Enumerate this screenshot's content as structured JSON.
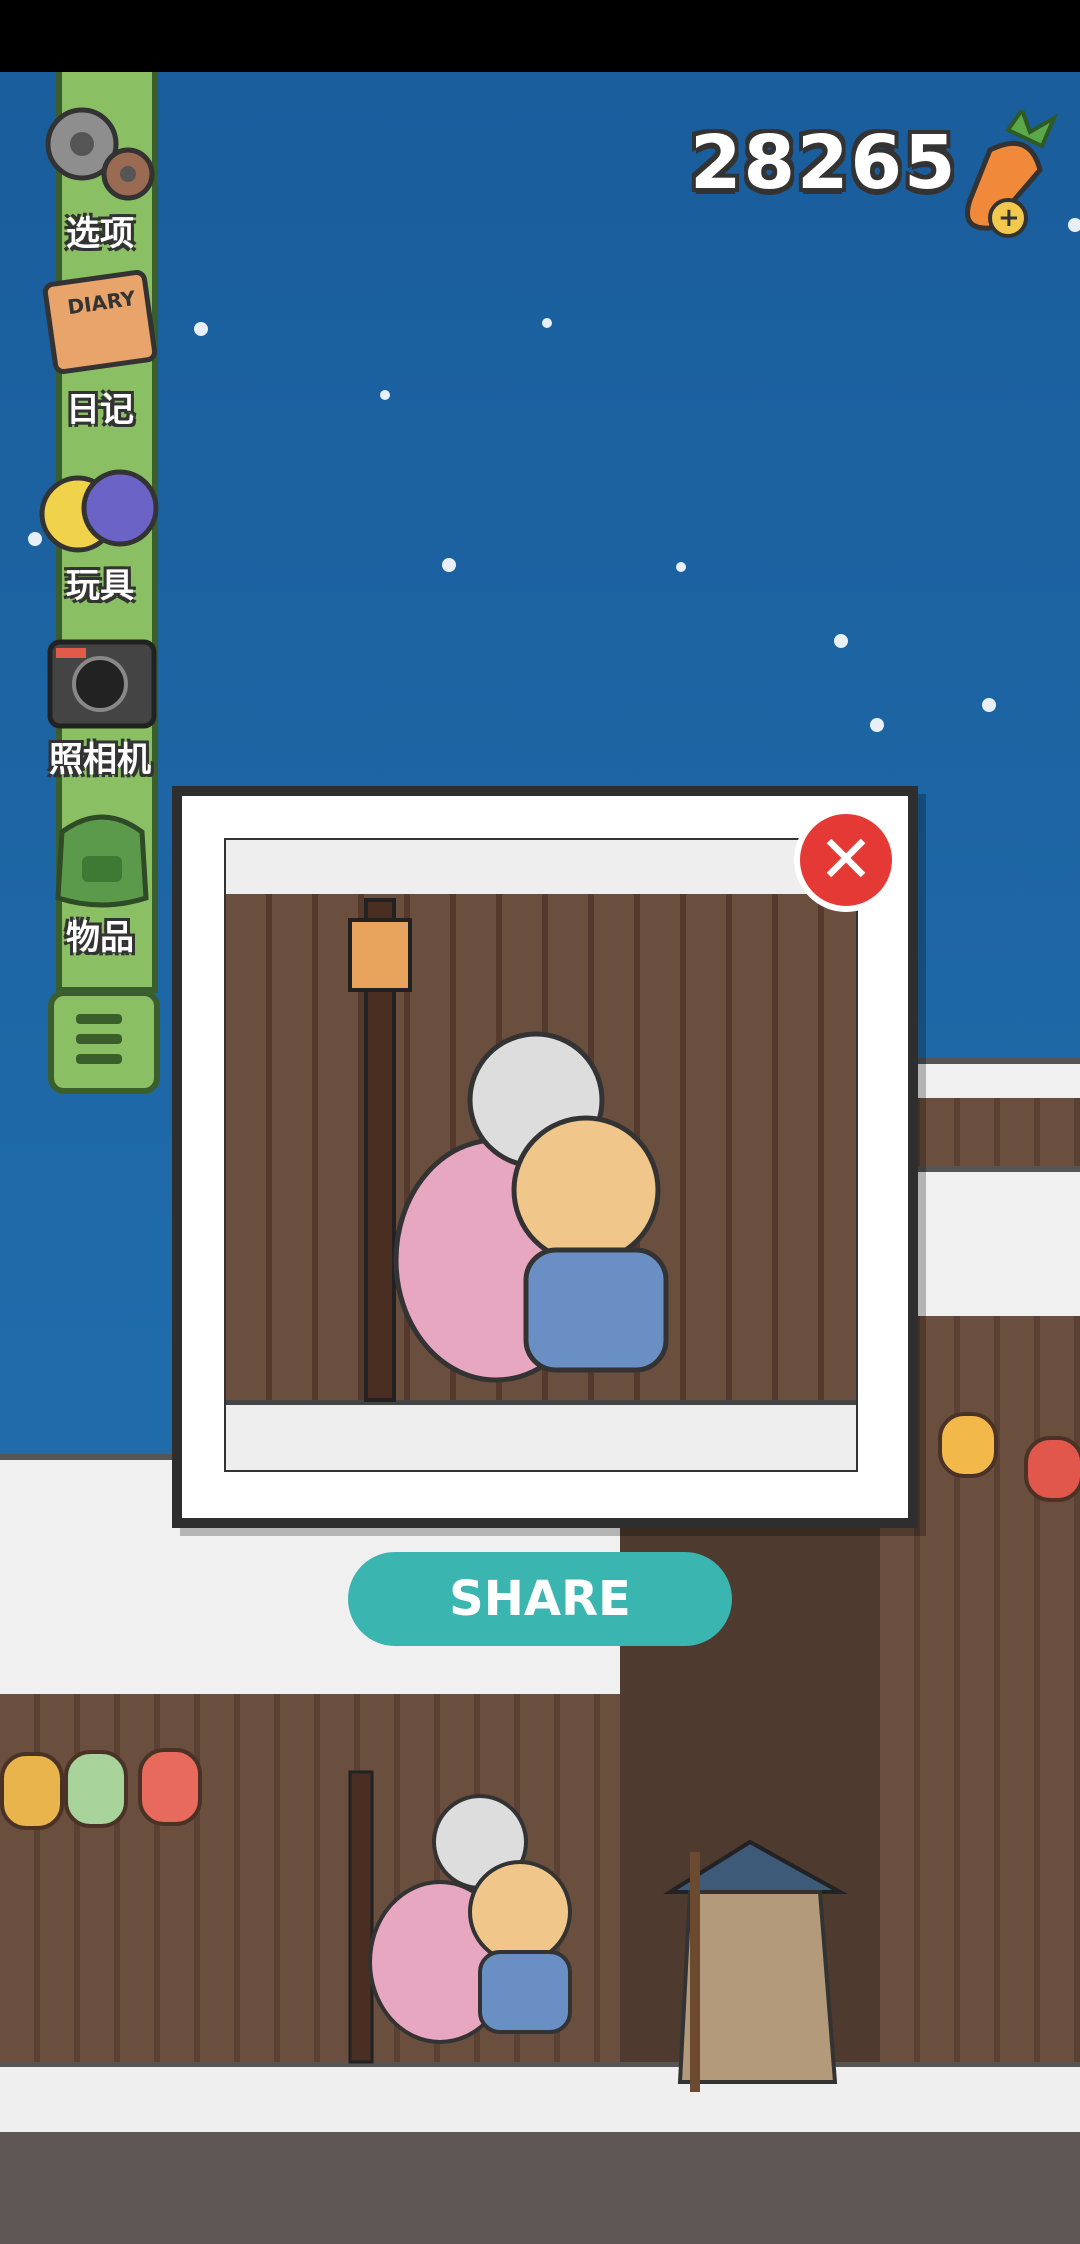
{
  "app": {
    "currency_amount": "28265"
  },
  "sidebar": {
    "items": [
      {
        "label": "选项",
        "icon": "gears-icon"
      },
      {
        "label": "日记",
        "icon": "diary-book-icon"
      },
      {
        "label": "玩具",
        "icon": "toy-balls-icon"
      },
      {
        "label": "照相机",
        "icon": "camera-icon"
      },
      {
        "label": "物品",
        "icon": "backpack-icon"
      }
    ],
    "menu_icon": "hamburger-menu-icon"
  },
  "icons": {
    "diary_text": "DIARY",
    "carrot_plus": "+"
  },
  "photo_popup": {
    "close_icon": "close-icon",
    "close_glyph": "✕",
    "share_label": "SHARE"
  },
  "colors": {
    "sky": "#1f6aa9",
    "sidebar_green": "#8ac063",
    "share_teal": "#3ab5b0",
    "close_red": "#e53935"
  }
}
